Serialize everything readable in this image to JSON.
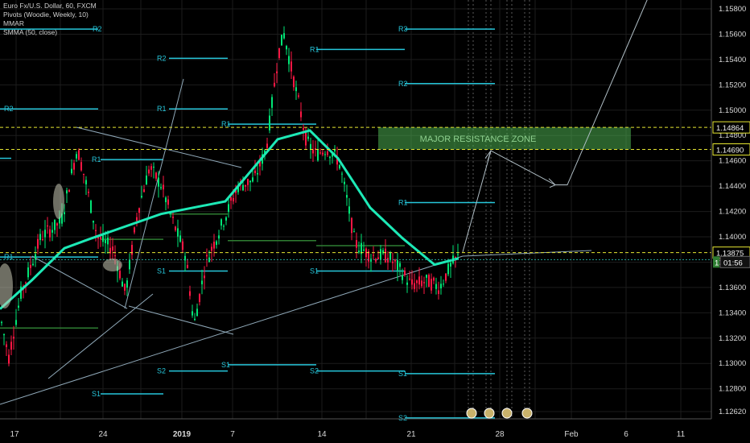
{
  "legend": {
    "symbol_line": "Euro Fx/U.S. Dollar, 60, FXCM",
    "indicator_1": "Pivots (Woodie, Weekly, 10)",
    "indicator_2": "MMAR",
    "indicator_3": "SMMA (50, close)"
  },
  "colors": {
    "background": "#000000",
    "pivot": "#26c6da",
    "resistance_zone": "#4caf50",
    "dashed_level": "#e6e632",
    "up_candle": "#00e676",
    "down_candle": "#ff1744",
    "smma": "#26c6da",
    "trend_line": "#8fa8b8",
    "projection": "#b0bec5",
    "axis_text": "#d8d8d8"
  },
  "chart_data": {
    "type": "candlestick",
    "y_axis": {
      "ticks": [
        "1.15800",
        "1.15600",
        "1.15400",
        "1.15200",
        "1.15000",
        "1.14800",
        "1.14600",
        "1.14400",
        "1.14200",
        "1.14000",
        "1.13800",
        "1.13600",
        "1.13400",
        "1.13200",
        "1.13000",
        "1.12800",
        "1.12620"
      ],
      "tick_values": [
        1.158,
        1.156,
        1.154,
        1.152,
        1.15,
        1.148,
        1.146,
        1.144,
        1.142,
        1.14,
        1.138,
        1.136,
        1.134,
        1.132,
        1.13,
        1.128,
        1.1262
      ],
      "ylim": [
        1.1254,
        1.1593
      ]
    },
    "x_axis": {
      "ticks": [
        "17",
        "24",
        "2019",
        "7",
        "14",
        "21",
        "28",
        "Feb",
        "6",
        "11"
      ]
    },
    "price_labels": [
      {
        "text": "1.14864",
        "value": 1.14864,
        "style": "dashed-yellow"
      },
      {
        "text": "1.14690",
        "value": 1.1469,
        "style": "dashed-yellow"
      },
      {
        "text": "1.13875",
        "value": 1.13875,
        "style": "dashed-yellow"
      },
      {
        "text": "1",
        "value": 1.1382,
        "style": "current"
      },
      {
        "text": "01:56",
        "value": 1.1382,
        "style": "countdown"
      }
    ],
    "resistance_zone": {
      "label": "MAJOR RESISTANCE ZONE",
      "low": 1.1469,
      "high": 1.14864
    },
    "pivot_labels": [
      {
        "text": "R2",
        "value": 1.1564
      },
      {
        "text": "R2",
        "value": 1.1541
      },
      {
        "text": "R2",
        "value": 1.1501
      },
      {
        "text": "R1",
        "value": 1.1501
      },
      {
        "text": "R1",
        "value": 1.1461
      },
      {
        "text": "R1",
        "value": 1.1489
      },
      {
        "text": "R1",
        "value": 1.1548
      },
      {
        "text": "R3",
        "value": 1.1564
      },
      {
        "text": "R2",
        "value": 1.1521
      },
      {
        "text": "R1",
        "value": 1.1427
      },
      {
        "text": "R1",
        "value": 1.1384
      },
      {
        "text": "S1",
        "value": 1.1373
      },
      {
        "text": "S1",
        "value": 1.1373
      },
      {
        "text": "S1",
        "value": 1.1299
      },
      {
        "text": "S2",
        "value": 1.1294
      },
      {
        "text": "S2",
        "value": 1.1294
      },
      {
        "text": "S1",
        "value": 1.1292
      },
      {
        "text": "S1",
        "value": 1.1276
      },
      {
        "text": "S2",
        "value": 1.1257
      }
    ],
    "smma_key_values": [
      1.1343,
      1.1366,
      1.1391,
      1.1398,
      1.1418,
      1.1428,
      1.1477,
      1.1484,
      1.1462,
      1.1423,
      1.1399,
      1.1378,
      1.1383
    ],
    "projection_values": [
      1.1388,
      1.1468,
      1.1441,
      1.1441,
      1.1603
    ]
  }
}
